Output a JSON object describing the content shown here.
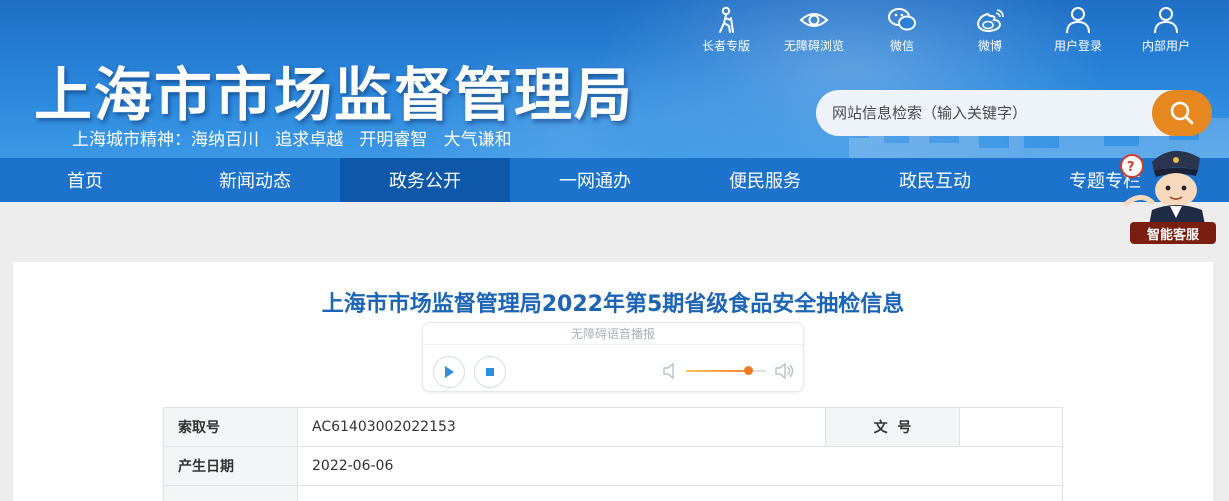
{
  "header": {
    "site_title": "上海市市场监督管理局",
    "spirit": "上海城市精神：海纳百川   追求卓越   开明睿智   大气谦和",
    "tools": [
      {
        "label": "长者专版",
        "icon": "elder-icon"
      },
      {
        "label": "无障碍浏览",
        "icon": "eye-icon"
      },
      {
        "label": "微信",
        "icon": "wechat-icon"
      },
      {
        "label": "微博",
        "icon": "weibo-icon"
      },
      {
        "label": "用户登录",
        "icon": "user-icon"
      },
      {
        "label": "内部用户",
        "icon": "user-icon"
      }
    ],
    "search_placeholder": "网站信息检索（输入关键字）"
  },
  "nav": {
    "items": [
      "首页",
      "新闻动态",
      "政务公开",
      "一网通办",
      "便民服务",
      "政民互动",
      "专题专栏"
    ],
    "active_index": 2
  },
  "assistant": {
    "label": "智能客服"
  },
  "article": {
    "title": "上海市市场监督管理局2022年第5期省级食品安全抽检信息",
    "player_title": "无障碍语音播报",
    "volume_level": 0.78,
    "info": {
      "index_label": "索取号",
      "index_value": "AC61403002022153",
      "doc_no_label": "文  号",
      "doc_no_value": "",
      "date_label": "产生日期",
      "date_value": "2022-06-06"
    }
  },
  "colors": {
    "nav_bg": "#1d72cc",
    "nav_active": "#0d58a8",
    "title": "#1c64b4",
    "search_btn": "#e6871f"
  }
}
